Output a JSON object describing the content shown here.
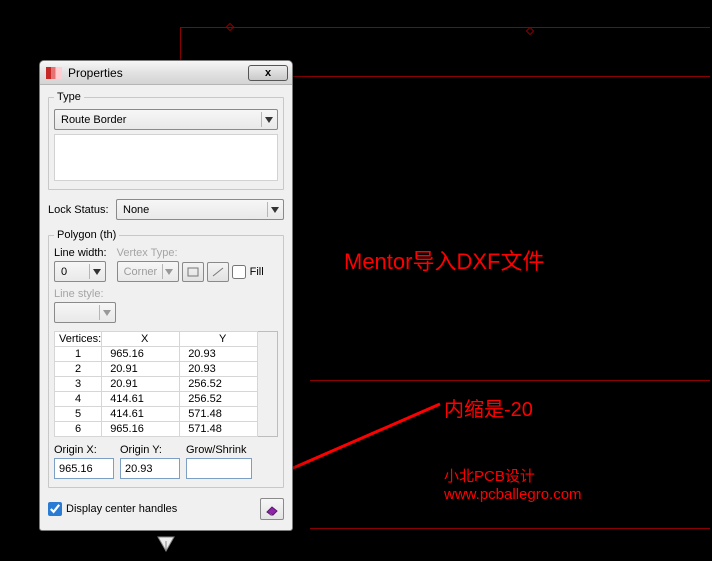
{
  "cad": {
    "marker1": "point-a",
    "marker2": "point-b"
  },
  "annotations": {
    "route_border": "Route Border",
    "mentor_dxf": "Mentor导入DXF文件",
    "shrink_note": "内缩是-20",
    "brand1": "小北PCB设计",
    "brand2": "www.pcballegro.com"
  },
  "dialog": {
    "title": "Properties",
    "close": "x",
    "type_group": "Type",
    "type_value": "Route Border",
    "lock_status_label": "Lock Status:",
    "lock_status_value": "None",
    "polygon_group": "Polygon (th)",
    "line_width_label": "Line width:",
    "line_width_value": "0",
    "vertex_type_label": "Vertex Type:",
    "vertex_type_value": "Corner",
    "fill_label": "Fill",
    "line_style_label": "Line style:",
    "vertices_label": "Vertices:",
    "col_x": "X",
    "col_y": "Y",
    "rows": [
      {
        "n": "1",
        "x": "965.16",
        "y": "20.93"
      },
      {
        "n": "2",
        "x": "20.91",
        "y": "20.93"
      },
      {
        "n": "3",
        "x": "20.91",
        "y": "256.52"
      },
      {
        "n": "4",
        "x": "414.61",
        "y": "256.52"
      },
      {
        "n": "5",
        "x": "414.61",
        "y": "571.48"
      },
      {
        "n": "6",
        "x": "965.16",
        "y": "571.48"
      }
    ],
    "origin_x_label": "Origin X:",
    "origin_y_label": "Origin Y:",
    "grow_shrink_label": "Grow/Shrink",
    "origin_x": "965.16",
    "origin_y": "20.93",
    "grow_shrink": "",
    "display_center": "Display center handles"
  }
}
